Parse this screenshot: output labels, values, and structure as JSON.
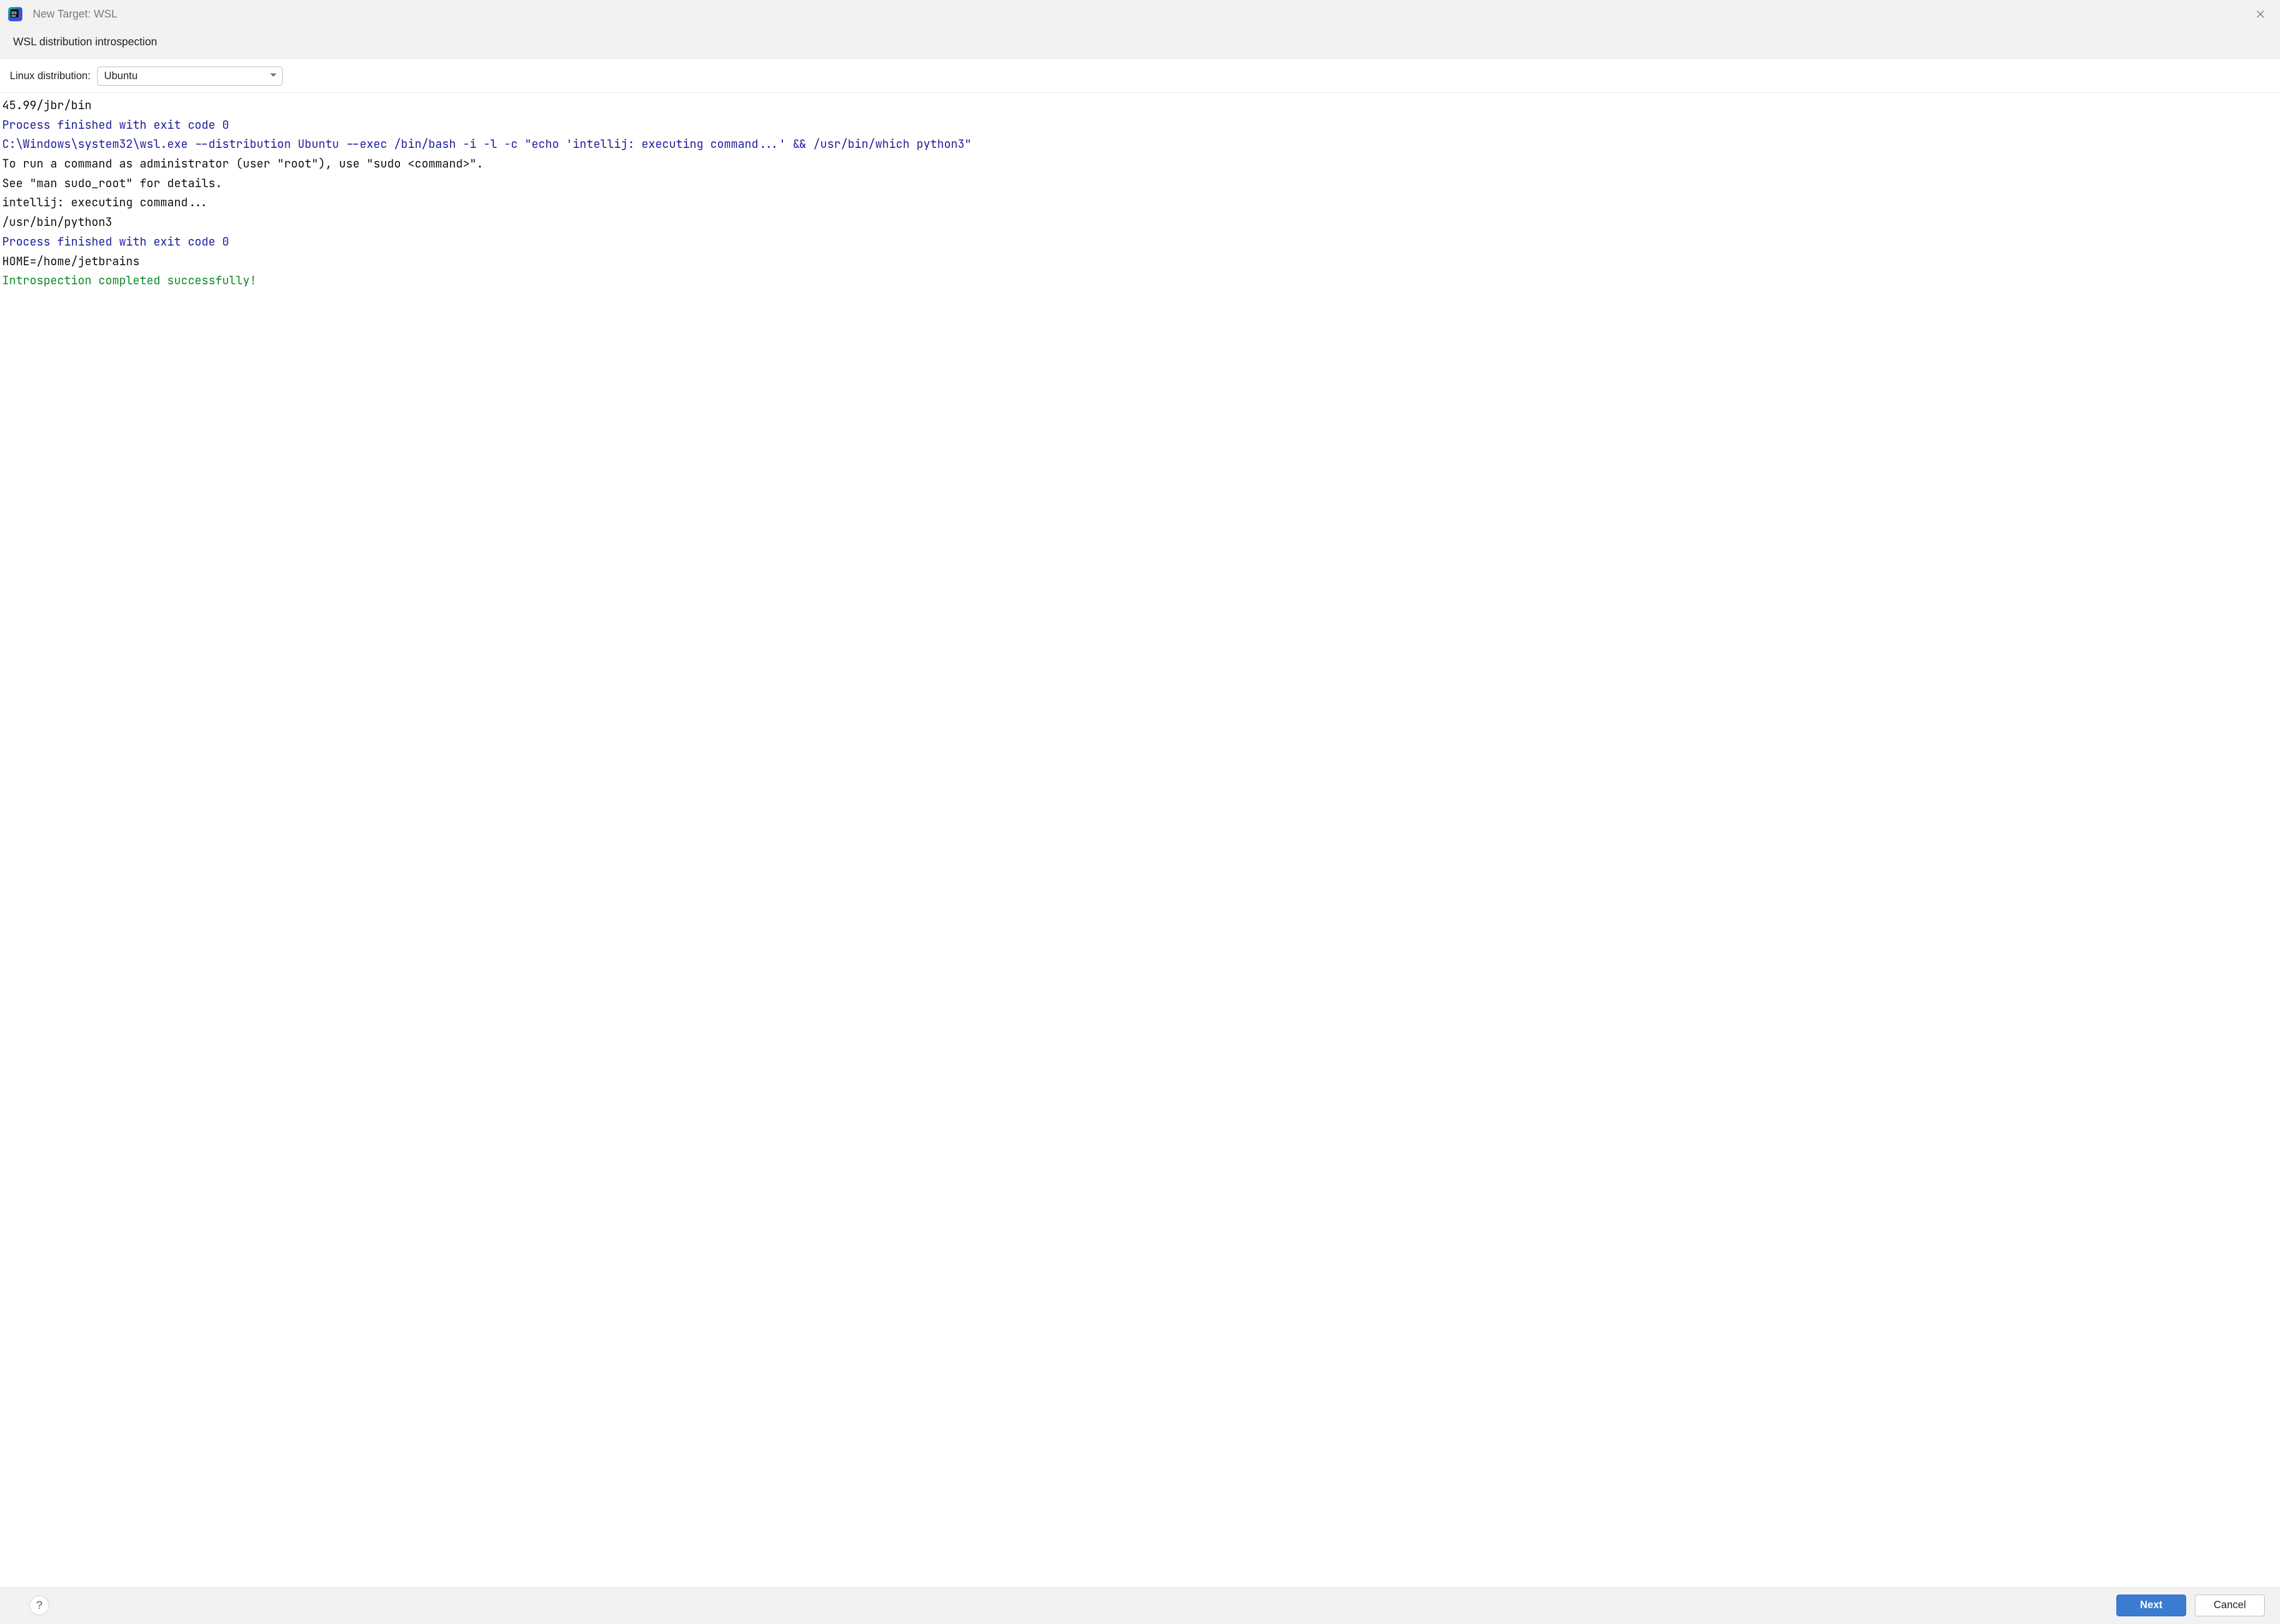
{
  "title": "New Target: WSL",
  "subtitle": "WSL distribution introspection",
  "form": {
    "label": "Linux distribution:",
    "selected": "Ubuntu"
  },
  "console": {
    "lines": [
      {
        "text": "45.99/jbr/bin",
        "color": "black"
      },
      {
        "text": "Process finished with exit code 0",
        "color": "blue"
      },
      {
        "text": "",
        "color": "black"
      },
      {
        "text": "C:\\Windows\\system32\\wsl.exe --distribution Ubuntu --exec /bin/bash -i -l -c \"echo 'intellij: executing command...' && /usr/bin/which python3\"",
        "color": "blue"
      },
      {
        "text": "To run a command as administrator (user \"root\"), use \"sudo <command>\".",
        "color": "black"
      },
      {
        "text": "See \"man sudo_root\" for details.",
        "color": "black"
      },
      {
        "text": "",
        "color": "black"
      },
      {
        "text": "intellij: executing command...",
        "color": "black"
      },
      {
        "text": "/usr/bin/python3",
        "color": "black"
      },
      {
        "text": "Process finished with exit code 0",
        "color": "blue"
      },
      {
        "text": "",
        "color": "black"
      },
      {
        "text": "HOME=/home/jetbrains",
        "color": "black"
      },
      {
        "text": "",
        "color": "black"
      },
      {
        "text": "Introspection completed successfully!",
        "color": "green"
      }
    ]
  },
  "footer": {
    "help_tooltip": "Help",
    "next_label": "Next",
    "cancel_label": "Cancel"
  }
}
